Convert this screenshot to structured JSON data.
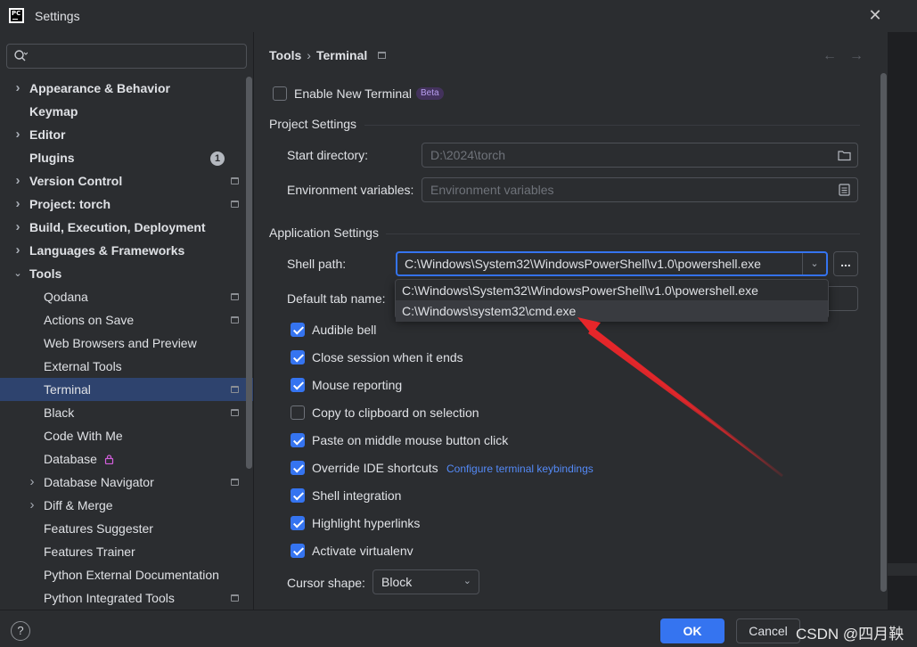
{
  "window": {
    "title": "Settings",
    "logo_text": "PC"
  },
  "search": {
    "placeholder": "",
    "value": ""
  },
  "sidebar": {
    "items": [
      {
        "label": "Appearance & Behavior",
        "level": 0,
        "chevron": "right",
        "bold": true
      },
      {
        "label": "Keymap",
        "level": 0,
        "bold": true
      },
      {
        "label": "Editor",
        "level": 0,
        "chevron": "right",
        "bold": true
      },
      {
        "label": "Plugins",
        "level": 0,
        "bold": true,
        "badge": "1"
      },
      {
        "label": "Version Control",
        "level": 0,
        "chevron": "right",
        "bold": true,
        "project_icon": true
      },
      {
        "label": "Project: torch",
        "level": 0,
        "chevron": "right",
        "bold": true,
        "project_icon": true
      },
      {
        "label": "Build, Execution, Deployment",
        "level": 0,
        "chevron": "right",
        "bold": true
      },
      {
        "label": "Languages & Frameworks",
        "level": 0,
        "chevron": "right",
        "bold": true
      },
      {
        "label": "Tools",
        "level": 0,
        "chevron": "down",
        "bold": true
      },
      {
        "label": "Qodana",
        "level": 1,
        "project_icon": true
      },
      {
        "label": "Actions on Save",
        "level": 1,
        "project_icon": true
      },
      {
        "label": "Web Browsers and Preview",
        "level": 1
      },
      {
        "label": "External Tools",
        "level": 1
      },
      {
        "label": "Terminal",
        "level": 1,
        "selected": true,
        "project_icon": true
      },
      {
        "label": "Black",
        "level": 1,
        "project_icon": true
      },
      {
        "label": "Code With Me",
        "level": 1
      },
      {
        "label": "Database",
        "level": 1,
        "lock": true
      },
      {
        "label": "Database Navigator",
        "level": 1,
        "chevron": "right",
        "project_icon": true
      },
      {
        "label": "Diff & Merge",
        "level": 1,
        "chevron": "right"
      },
      {
        "label": "Features Suggester",
        "level": 1
      },
      {
        "label": "Features Trainer",
        "level": 1
      },
      {
        "label": "Python External Documentation",
        "level": 1
      },
      {
        "label": "Python Integrated Tools",
        "level": 1,
        "project_icon": true
      }
    ]
  },
  "breadcrumb": {
    "parent": "Tools",
    "separator": "›",
    "current": "Terminal"
  },
  "enable_new_terminal": {
    "label": "Enable New Terminal",
    "badge": "Beta",
    "checked": false
  },
  "project_settings": {
    "title": "Project Settings",
    "start_directory": {
      "label": "Start directory:",
      "placeholder": "D:\\2024\\torch"
    },
    "env_vars": {
      "label": "Environment variables:",
      "placeholder": "Environment variables"
    }
  },
  "application_settings": {
    "title": "Application Settings",
    "shell_path": {
      "label": "Shell path:",
      "value": "C:\\Windows\\System32\\WindowsPowerShell\\v1.0\\powershell.exe",
      "browse_label": "..."
    },
    "shell_options": [
      "C:\\Windows\\System32\\WindowsPowerShell\\v1.0\\powershell.exe",
      "C:\\Windows\\system32\\cmd.exe"
    ],
    "default_tab_name": {
      "label": "Default tab name:"
    },
    "checkboxes": [
      {
        "label": "Audible bell",
        "checked": true
      },
      {
        "label": "Close session when it ends",
        "checked": true
      },
      {
        "label": "Mouse reporting",
        "checked": true
      },
      {
        "label": "Copy to clipboard on selection",
        "checked": false
      },
      {
        "label": "Paste on middle mouse button click",
        "checked": true
      },
      {
        "label": "Override IDE shortcuts",
        "checked": true,
        "link": "Configure terminal keybindings"
      },
      {
        "label": "Shell integration",
        "checked": true
      },
      {
        "label": "Highlight hyperlinks",
        "checked": true
      },
      {
        "label": "Activate virtualenv",
        "checked": true
      }
    ],
    "cursor_shape": {
      "label": "Cursor shape:",
      "value": "Block"
    }
  },
  "footer": {
    "help": "?",
    "ok": "OK",
    "cancel": "Cancel",
    "watermark": "CSDN @四月鞅"
  },
  "colors": {
    "accent": "#3574f0",
    "selection": "#2e436e",
    "background": "#2b2d30",
    "annotation_arrow": "#e8262a"
  }
}
